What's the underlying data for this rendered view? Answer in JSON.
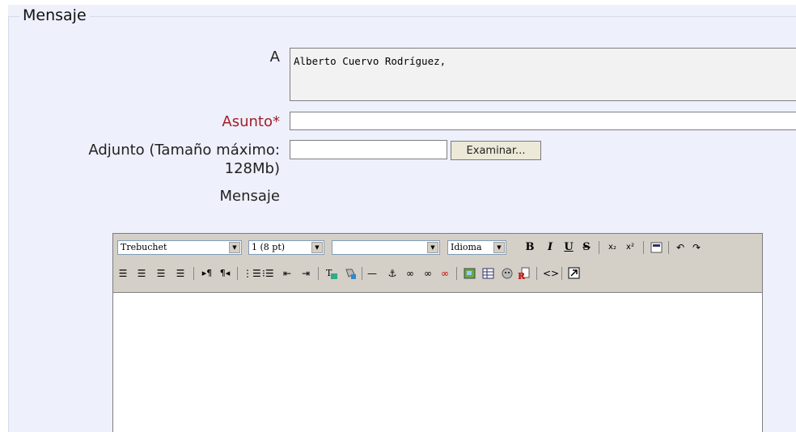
{
  "fieldset": {
    "legend": "Mensaje"
  },
  "form": {
    "to_label": "A",
    "to_value": "Alberto Cuervo Rodríguez,",
    "subject_label": "Asunto*",
    "subject_value": "",
    "attachment_label_line1": "Adjunto (Tamaño máximo:",
    "attachment_label_line2": "128Mb)",
    "attachment_value": "",
    "browse_label": "Examinar...",
    "message_label": "Mensaje"
  },
  "editor": {
    "font_family": "Trebuchet",
    "font_size": "1 (8 pt)",
    "format": "",
    "language": "Idioma",
    "bold_glyph": "B",
    "italic_glyph": "I",
    "underline_glyph": "U",
    "strike_glyph": "S",
    "content": ""
  }
}
